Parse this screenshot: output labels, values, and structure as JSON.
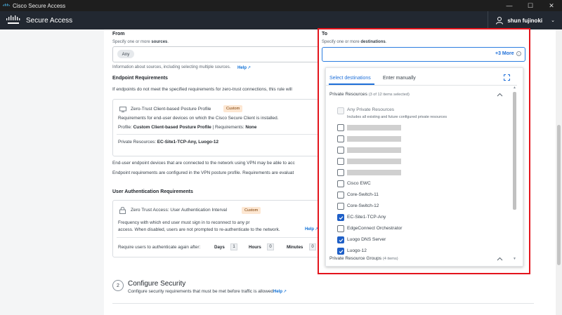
{
  "window": {
    "title": "Cisco Secure Access",
    "minimize": "—",
    "maximize": "☐",
    "close": "✕"
  },
  "app": {
    "title": "Secure Access",
    "user_name": "shun fujinoki",
    "user_caret": "⌄"
  },
  "from": {
    "label": "From",
    "hint_prefix": "Specify one or more ",
    "hint_bold": "sources",
    "hint_suffix": ".",
    "chip": "Any",
    "info": "Information about sources, including selecting multiple sources.",
    "help": "Help"
  },
  "endpoint": {
    "heading": "Endpoint Requirements",
    "desc": "If endpoints do not meet the specified requirements for zero-trust connections, this rule will",
    "card_title": "Zero-Trust Client-based Posture Profile",
    "badge": "Custom",
    "card_desc": "Requirements for end-user devices on which the Cisco Secure Client is installed.",
    "profile_label": "Profile:",
    "profile_value": "Custom Client-based Posture Profile",
    "requirements_label": "| Requirements:",
    "requirements_value": "None",
    "resources_label": "Private Resources:",
    "resources_value": "EC-Site1-TCP-Any, Luogo-12",
    "vpn_note": "End-user endpoint devices that are connected to the network using VPN may be able to acc",
    "posture_note": "Endpoint requirements are configured in the VPN posture profile. Requirements are evaluat"
  },
  "user_auth": {
    "heading": "User Authentication Requirements",
    "card_title": "Zero Trust Access: User Authentication Interval",
    "badge": "Custom",
    "desc_line1": "Frequency with which end user must sign in to reconnect to any pr",
    "desc_line2": "access. When disabled, users are not prompted to re-authenticate to the network.",
    "help": "Help",
    "reauth_label": "Require users to authenticate again after:",
    "days_label": "Days",
    "days_value": "1",
    "hours_label": "Hours",
    "hours_value": "0",
    "minutes_label": "Minutes",
    "minutes_value": "0"
  },
  "configure": {
    "step": "2",
    "title": "Configure Security",
    "desc": "Configure security requirements that must be met before traffic is allowed.",
    "help": "Help"
  },
  "to": {
    "label": "To",
    "hint_prefix": "Specify one or more ",
    "hint_bold": "destinations",
    "hint_suffix": ".",
    "more": "+3 More",
    "tabs": [
      "Select destinations",
      "Enter manually"
    ],
    "group1_name": "Private Resources",
    "group1_count": "(3 of 12 items selected)",
    "any_label": "Any Private Resources",
    "any_desc": "Includes all existing and future configured private resources",
    "items": [
      {
        "label": "",
        "checked": false,
        "redacted": true
      },
      {
        "label": "",
        "checked": false,
        "redacted": true
      },
      {
        "label": "",
        "checked": false,
        "redacted": true
      },
      {
        "label": "",
        "checked": false,
        "redacted": true
      },
      {
        "label": "",
        "checked": false,
        "redacted": true
      },
      {
        "label": "Cisco EWC",
        "checked": false,
        "redacted": false
      },
      {
        "label": "Core-Switch-11",
        "checked": false,
        "redacted": false
      },
      {
        "label": "Core-Switch-12",
        "checked": false,
        "redacted": false
      },
      {
        "label": "EC-Site1-TCP-Any",
        "checked": true,
        "redacted": false
      },
      {
        "label": "EdgeConnect Orchestrator",
        "checked": false,
        "redacted": false
      },
      {
        "label": "Luogo DNS Server",
        "checked": true,
        "redacted": false
      },
      {
        "label": "Luogo-12",
        "checked": true,
        "redacted": false
      }
    ],
    "group2_name": "Private Resource Groups",
    "group2_count": "(4 items)"
  },
  "colors": {
    "accent": "#1e6fd9",
    "highlight": "#e3141c",
    "header_bg": "#222831",
    "checked": "#1e5fc7"
  },
  "icons": [
    "cisco-logo",
    "user-icon",
    "monitor-icon",
    "external-link-icon",
    "expand-icon",
    "chevron-up-icon",
    "checkmark-icon",
    "info-icon"
  ]
}
